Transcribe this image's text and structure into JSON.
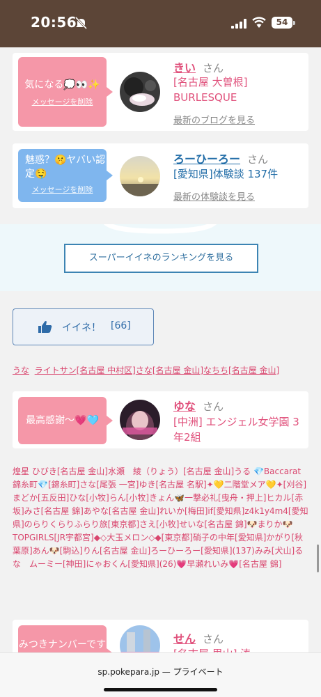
{
  "status": {
    "time": "20:56",
    "battery": "54"
  },
  "cards": [
    {
      "message": "気になる💭👀✨",
      "delete_label": "メッセージを削除",
      "name": "きい",
      "suffix": "さん",
      "info": "[名古屋 大曽根] BURLESQUE",
      "link": "最新のブログを見る"
    },
    {
      "message": "魅惑？🤫ヤバい認定🤤",
      "delete_label": "メッセージを削除",
      "name": "ろーひーろー",
      "suffix": "さん",
      "info": "[愛知県]体験談 137件",
      "link": "最新の体験談を見る"
    },
    {
      "message": "最高感謝～💗🩵",
      "name": "ゆな",
      "suffix": "さん",
      "info": "[中洲] エンジェル女学園 3年2組"
    },
    {
      "message": "みつきナンバーです",
      "name": "せん",
      "suffix": "さん",
      "info": "[名古屋 里山] 湊"
    }
  ],
  "ranking_button": "スーパーイイネのランキングを見る",
  "like": {
    "label": "イイネ！",
    "count": "[66]"
  },
  "names_line": [
    "うな",
    "ライトサン[名古屋 中村区]",
    "さな[名古屋 金山]",
    "なちち[名古屋 金山]"
  ],
  "name_list": "煌星 ひびき[名古屋 金山]水瀬　綾（りょう）[名古屋 金山]うる 💎Baccarat錦糸町💎[錦糸町]さな[尾張 一宮]ゆき[名古屋 名駅]✦💛二階堂メア💛✦[刈谷]まどか[五反田]ひな[小牧]らん[小牧]きょん🦋一撃必礼[曳舟・押上]ヒカル[赤坂]みさ[名古屋 錦]あやな[名古屋 金山]れいか[梅田]if[愛知県]z4k1y4m4[愛知県]のらりくらりふらり旅[東京都]さえ[小牧]せいな[名古屋 錦]🐶まりか🐶TOPGIRLS[JR宇都宮]◆◇大玉メロン◇◆[東京都]硝子の中年[愛知県]かがり[秋葉原]あん🐶[駒込]りん[名古屋 金山]ろーひーろー[愛知県](137)みみ[犬山]るな　ムーミー[神田]にゃおくん[愛知県](26)💗早瀬れいみ💗[名古屋 錦]",
  "url": "sp.pokepara.jp — プライベート",
  "colors": {
    "pink": "#f597a8",
    "blue": "#7fb6ee",
    "accent": "#e0507b",
    "link_blue": "#236ea8",
    "status_bar": "#5c4537"
  }
}
